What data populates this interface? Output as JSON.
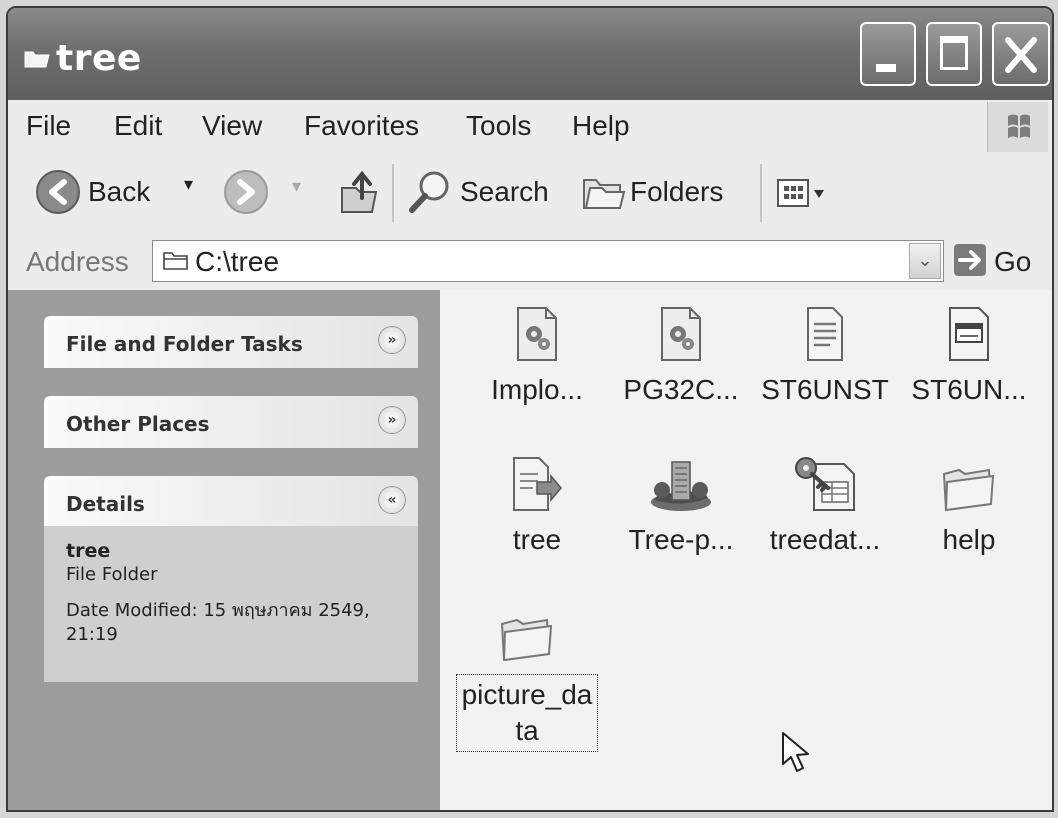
{
  "window": {
    "title": "tree"
  },
  "menu": [
    "File",
    "Edit",
    "View",
    "Favorites",
    "Tools",
    "Help"
  ],
  "toolbar": {
    "back_label": "Back",
    "search_label": "Search",
    "folders_label": "Folders"
  },
  "address": {
    "label": "Address",
    "value": "C:\\tree",
    "go_label": "Go"
  },
  "tasks": {
    "file_folder_tasks": "File and Folder Tasks",
    "other_places": "Other Places",
    "details": "Details",
    "details_name": "tree",
    "details_type": "File Folder",
    "details_date": "Date Modified: 15 พฤษภาคม 2549, 21:19"
  },
  "files": [
    {
      "label": "Implo...",
      "icon": "gear-document-icon"
    },
    {
      "label": "PG32C...",
      "icon": "gear-document-icon"
    },
    {
      "label": "ST6UNST",
      "icon": "text-document-icon"
    },
    {
      "label": "ST6UN...",
      "icon": "window-document-icon"
    },
    {
      "label": "tree",
      "icon": "installer-document-icon"
    },
    {
      "label": "Tree-p...",
      "icon": "building-icon"
    },
    {
      "label": "treedat...",
      "icon": "key-document-icon"
    },
    {
      "label": "help",
      "icon": "folder-icon"
    },
    {
      "label": "picture_data",
      "icon": "folder-icon"
    }
  ]
}
